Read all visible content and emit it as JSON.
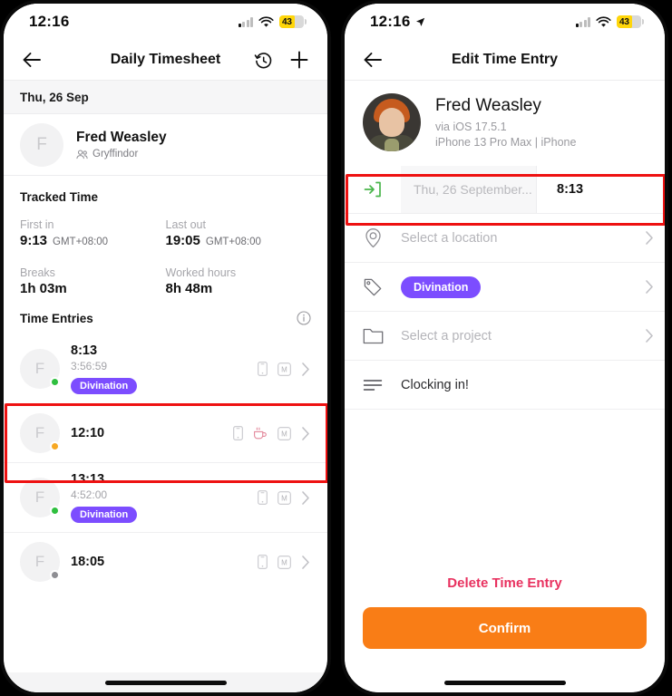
{
  "status_bar_left": {
    "time": "12:16",
    "battery_percent": "43",
    "location_arrow": false
  },
  "status_bar_right": {
    "time": "12:16",
    "battery_percent": "43",
    "location_arrow": true
  },
  "left_phone": {
    "nav": {
      "back_icon": "arrow-left-icon",
      "title": "Daily Timesheet",
      "history_icon": "clock-history-icon",
      "add_icon": "plus-icon"
    },
    "date_header": "Thu, 26 Sep",
    "person": {
      "initial": "F",
      "name": "Fred Weasley",
      "team_icon": "people-icon",
      "team": "Gryffindor"
    },
    "tracked_time": {
      "title": "Tracked Time",
      "stats": [
        {
          "label": "First in",
          "value": "9:13",
          "tz": "GMT+08:00"
        },
        {
          "label": "Last out",
          "value": "19:05",
          "tz": "GMT+08:00"
        },
        {
          "label": "Breaks",
          "value": "1h 03m",
          "tz": ""
        },
        {
          "label": "Worked hours",
          "value": "8h 48m",
          "tz": ""
        }
      ]
    },
    "time_entries": {
      "title": "Time Entries",
      "info_icon": "info-icon",
      "items": [
        {
          "initial": "F",
          "status": "green",
          "time": "8:13",
          "duration": "3:56:59",
          "tag": "Divination",
          "icons": [
            "mobile-icon",
            "m-badge-icon",
            "chevron-right-icon"
          ],
          "highlighted": true
        },
        {
          "initial": "F",
          "status": "orange",
          "time": "12:10",
          "duration": "",
          "tag": "",
          "icons": [
            "mobile-icon",
            "coffee-icon",
            "m-badge-icon",
            "chevron-right-icon"
          ],
          "highlighted": false
        },
        {
          "initial": "F",
          "status": "green",
          "time": "13:13",
          "duration": "4:52:00",
          "tag": "Divination",
          "icons": [
            "mobile-icon",
            "m-badge-icon",
            "chevron-right-icon"
          ],
          "highlighted": false
        },
        {
          "initial": "F",
          "status": "gray",
          "time": "18:05",
          "duration": "",
          "tag": "",
          "icons": [
            "mobile-icon",
            "m-badge-icon",
            "chevron-right-icon"
          ],
          "highlighted": false
        }
      ]
    }
  },
  "right_phone": {
    "nav": {
      "back_icon": "arrow-left-icon",
      "title": "Edit Time Entry"
    },
    "profile": {
      "avatar": "photo-avatar",
      "name": "Fred Weasley",
      "via": "via iOS 17.5.1",
      "device": "iPhone 13 Pro Max | iPhone"
    },
    "form": {
      "datetime": {
        "icon": "clock-in-arrow-icon",
        "date": "Thu, 26 September...",
        "time": "8:13",
        "highlighted": true
      },
      "location": {
        "icon": "location-pin-icon",
        "placeholder": "Select a location",
        "chevron": "chevron-right-icon"
      },
      "tag": {
        "icon": "tag-icon",
        "value": "Divination",
        "chevron": "chevron-right-icon"
      },
      "project": {
        "icon": "folder-icon",
        "placeholder": "Select a project",
        "chevron": "chevron-right-icon"
      },
      "note": {
        "icon": "note-lines-icon",
        "value": "Clocking in!"
      }
    },
    "delete_label": "Delete Time Entry",
    "confirm_label": "Confirm"
  },
  "colors": {
    "tag_purple": "#7c4dff",
    "confirm_orange": "#f97d16",
    "delete_pink": "#e8315f",
    "status_green": "#2fbf3f",
    "status_orange": "#f7a823",
    "status_gray": "#8e8e93",
    "highlight_red": "#ee1111",
    "battery_yellow": "#ffd60a"
  }
}
